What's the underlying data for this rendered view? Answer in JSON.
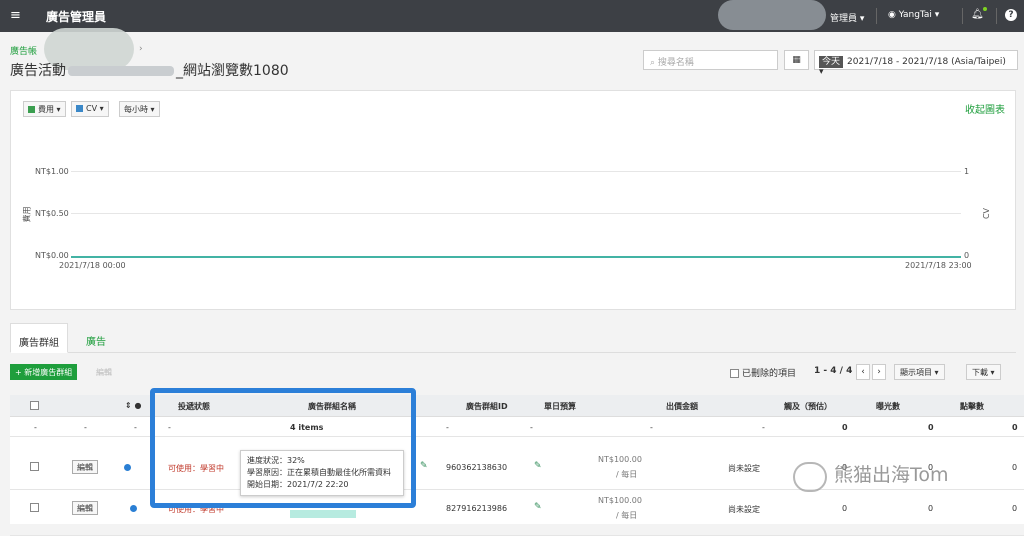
{
  "topbar": {
    "menu_icon": "hamburger-menu-icon",
    "title": "廣告管理員",
    "manager_label": "管理員 ▾",
    "user": "YangTai ▾",
    "bell_icon": "bell-icon",
    "help": "?"
  },
  "breadcrumb": {
    "text": "廣告帳",
    "arrow": "›"
  },
  "page": {
    "title_prefix": "廣告活動",
    "title_suffix": "_網站瀏覽數1080"
  },
  "search": {
    "placeholder": "搜尋名稱"
  },
  "daterange": {
    "today": "今天",
    "range": "2021/7/18 - 2021/7/18 (Asia/Taipei) ▾"
  },
  "chart": {
    "metrics": [
      {
        "label": "費用 ▾",
        "color": "#3a9e4f"
      },
      {
        "label": "CV ▾",
        "color": "#3b88c8"
      }
    ],
    "interval": "每小時 ▾",
    "collapse": "收起圖表",
    "yticks": [
      "NT$1.00",
      "NT$0.50",
      "NT$0.00"
    ],
    "yticks_right": [
      "1",
      "0"
    ],
    "ylabel_left": "費用",
    "ylabel_right": "CV",
    "xstart": "2021/7/18 00:00",
    "xend": "2021/7/18 23:00"
  },
  "chart_data": {
    "type": "line",
    "x": [
      "2021/7/18 00:00",
      "2021/7/18 23:00"
    ],
    "series": [
      {
        "name": "費用",
        "values": [
          0,
          0
        ]
      },
      {
        "name": "CV",
        "values": [
          0,
          0
        ]
      }
    ],
    "ylim": [
      0,
      1
    ],
    "ylabel": "費用",
    "y2label": "CV",
    "grid": true
  },
  "tabs": [
    {
      "label": "廣告群組"
    },
    {
      "label": "廣告"
    }
  ],
  "toolbar": {
    "add": "新增廣告群組",
    "edit": "編輯",
    "deleted": "已刪除的項目",
    "pager": "1 - 4 / 4",
    "prev": "‹",
    "next": "›",
    "display": "顯示項目 ▾",
    "download": "下載 ▾"
  },
  "table": {
    "headers": [
      "投遞狀態",
      "廣告群組名稱",
      "廣告群組ID",
      "單日預算",
      "出價金額",
      "觸及（預估）",
      "曝光數",
      "點擊數"
    ],
    "summary": {
      "dash": "-",
      "items": "4 items",
      "zero": "0"
    },
    "rows": [
      {
        "edit": "編輯",
        "status": "可使用：學習中",
        "id": "960362138630",
        "budget": "NT$100.00",
        "per_day": "/ 每日",
        "bid": "尚未設定",
        "reach": "0",
        "imp": "0",
        "clicks": "0"
      },
      {
        "edit": "編輯",
        "status": "可使用：學習中",
        "id": "827916213986",
        "budget": "NT$100.00",
        "per_day": "/ 每日",
        "bid": "尚未設定",
        "reach": "0",
        "imp": "0",
        "clicks": "0"
      }
    ]
  },
  "tooltip": {
    "line1": "進度狀況：32%",
    "line2": "學習原因：正在累積自動最佳化所需資料",
    "line3": "開始日期：2021/7/2 22:20"
  },
  "watermark": "熊猫出海Tom"
}
